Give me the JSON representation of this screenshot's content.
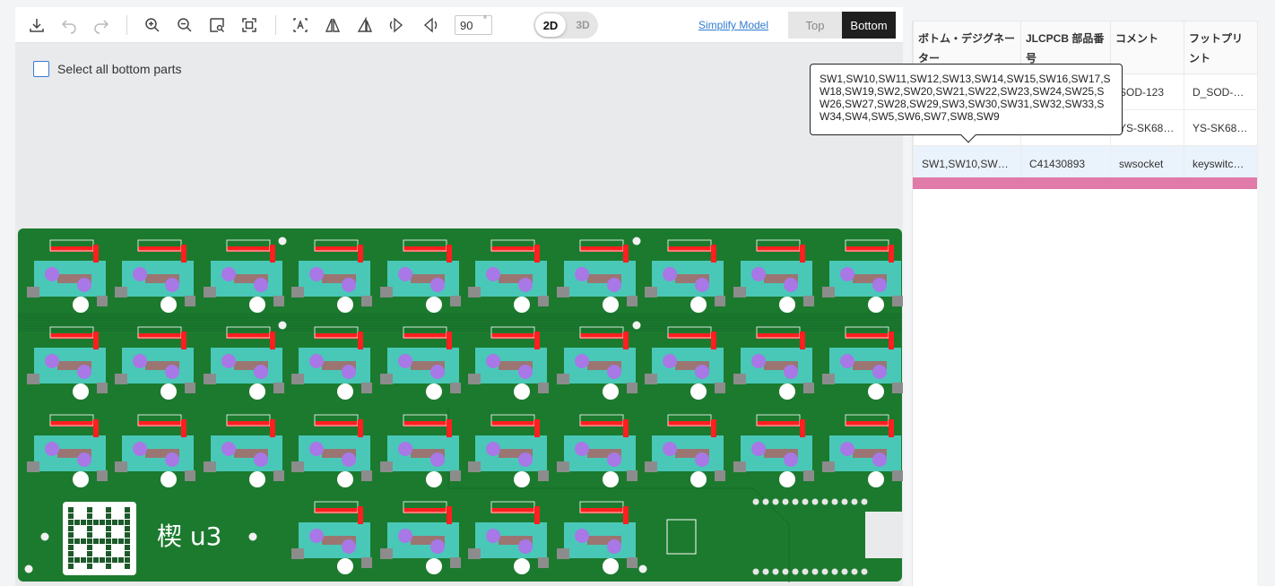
{
  "toolbar": {
    "rotation_value": "90",
    "rotation_unit": "°",
    "view_2d": "2D",
    "view_3d": "3D",
    "simplify_link": "Simplify Model",
    "side_top": "Top",
    "side_bottom": "Bottom",
    "icons": [
      "download-icon",
      "undo-icon",
      "redo-icon",
      "zoom-in-icon",
      "zoom-out-icon",
      "zoom-area-icon",
      "fit-view-icon",
      "text-toggle-icon",
      "flip-horizontal-icon",
      "flip-vertical-icon",
      "rotate-left-icon",
      "rotate-right-icon"
    ]
  },
  "viewer": {
    "select_all_label": "Select all bottom parts",
    "board_label": "楔 u3",
    "colors": {
      "board": "#1c7a2e",
      "pad": "#34e0d6",
      "marker": "#ff1f1f",
      "hole": "#a778e6"
    }
  },
  "table": {
    "headers": [
      "ボトム・デジグネーター",
      "JLCPCB 部品番号",
      "コメント",
      "フットプリント"
    ],
    "rows": [
      {
        "designator": "",
        "part": "",
        "comment": "SOD-123",
        "footprint": "D_SOD-1…"
      },
      {
        "designator": "",
        "part": "",
        "comment": "YS-SK68…",
        "footprint": "YS-SK68…"
      },
      {
        "designator": "SW1,SW10,SW1…",
        "part": "C41430893",
        "comment": "swsocket",
        "footprint": "keyswitc…"
      }
    ]
  },
  "tooltip": {
    "text": "SW1,SW10,SW11,SW12,SW13,SW14,SW15,SW16,SW17,SW18,SW19,SW2,SW20,SW21,SW22,SW23,SW24,SW25,SW26,SW27,SW28,SW29,SW3,SW30,SW31,SW32,SW33,SW34,SW4,SW5,SW6,SW7,SW8,SW9"
  }
}
